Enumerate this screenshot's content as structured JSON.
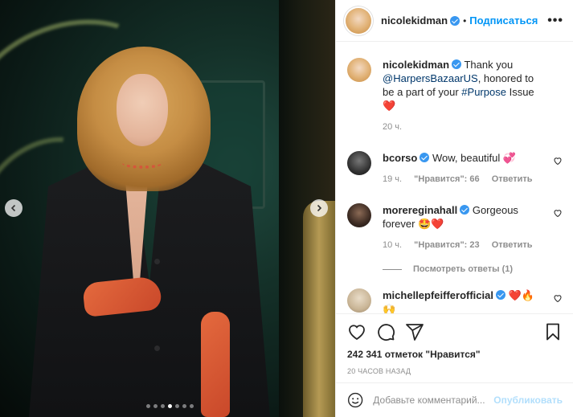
{
  "post": {
    "username": "nicolekidman",
    "follow_label": "Подписаться",
    "more_label": "•••",
    "dot_sep": "•",
    "carousel_total": 7,
    "carousel_active": 4
  },
  "caption": {
    "username": "nicolekidman",
    "text_1": "Thank you",
    "mention": "@HarpersBazaarUS",
    "text_2": ", honored to be a part of your",
    "hashtag": "#Purpose",
    "text_3": "Issue",
    "emoji": "❤️",
    "time": "20 ч."
  },
  "comments": [
    {
      "username": "bcorso",
      "text": "Wow, beautiful",
      "emoji": "💞",
      "time": "19 ч.",
      "likes": "\"Нравится\": 66",
      "reply": "Ответить"
    },
    {
      "username": "morereginahall",
      "text": "Gorgeous forever",
      "emoji": "🤩❤️",
      "time": "10 ч.",
      "likes": "\"Нравится\": 23",
      "reply": "Ответить"
    },
    {
      "username": "michellepfeifferofficial",
      "text": "",
      "emoji": "❤️🔥🙌",
      "time": "",
      "likes": "",
      "reply": ""
    }
  ],
  "view_replies": "Посмотреть ответы (1)",
  "actions": {
    "likes": "242 341 отметок \"Нравится\"",
    "time": "20 часов назад"
  },
  "add_comment": {
    "placeholder": "Добавьте комментарий...",
    "publish_label": "Опубликовать"
  },
  "icons": [
    "heart-icon",
    "comment-icon",
    "share-icon",
    "bookmark-icon",
    "emoji-icon",
    "chevron-left-icon",
    "chevron-right-icon",
    "verified-icon",
    "more-icon"
  ],
  "colors": {
    "link": "#0095f6",
    "verified": "#3897f0",
    "muted": "#8e8e8e",
    "heart": "#ed4956"
  }
}
